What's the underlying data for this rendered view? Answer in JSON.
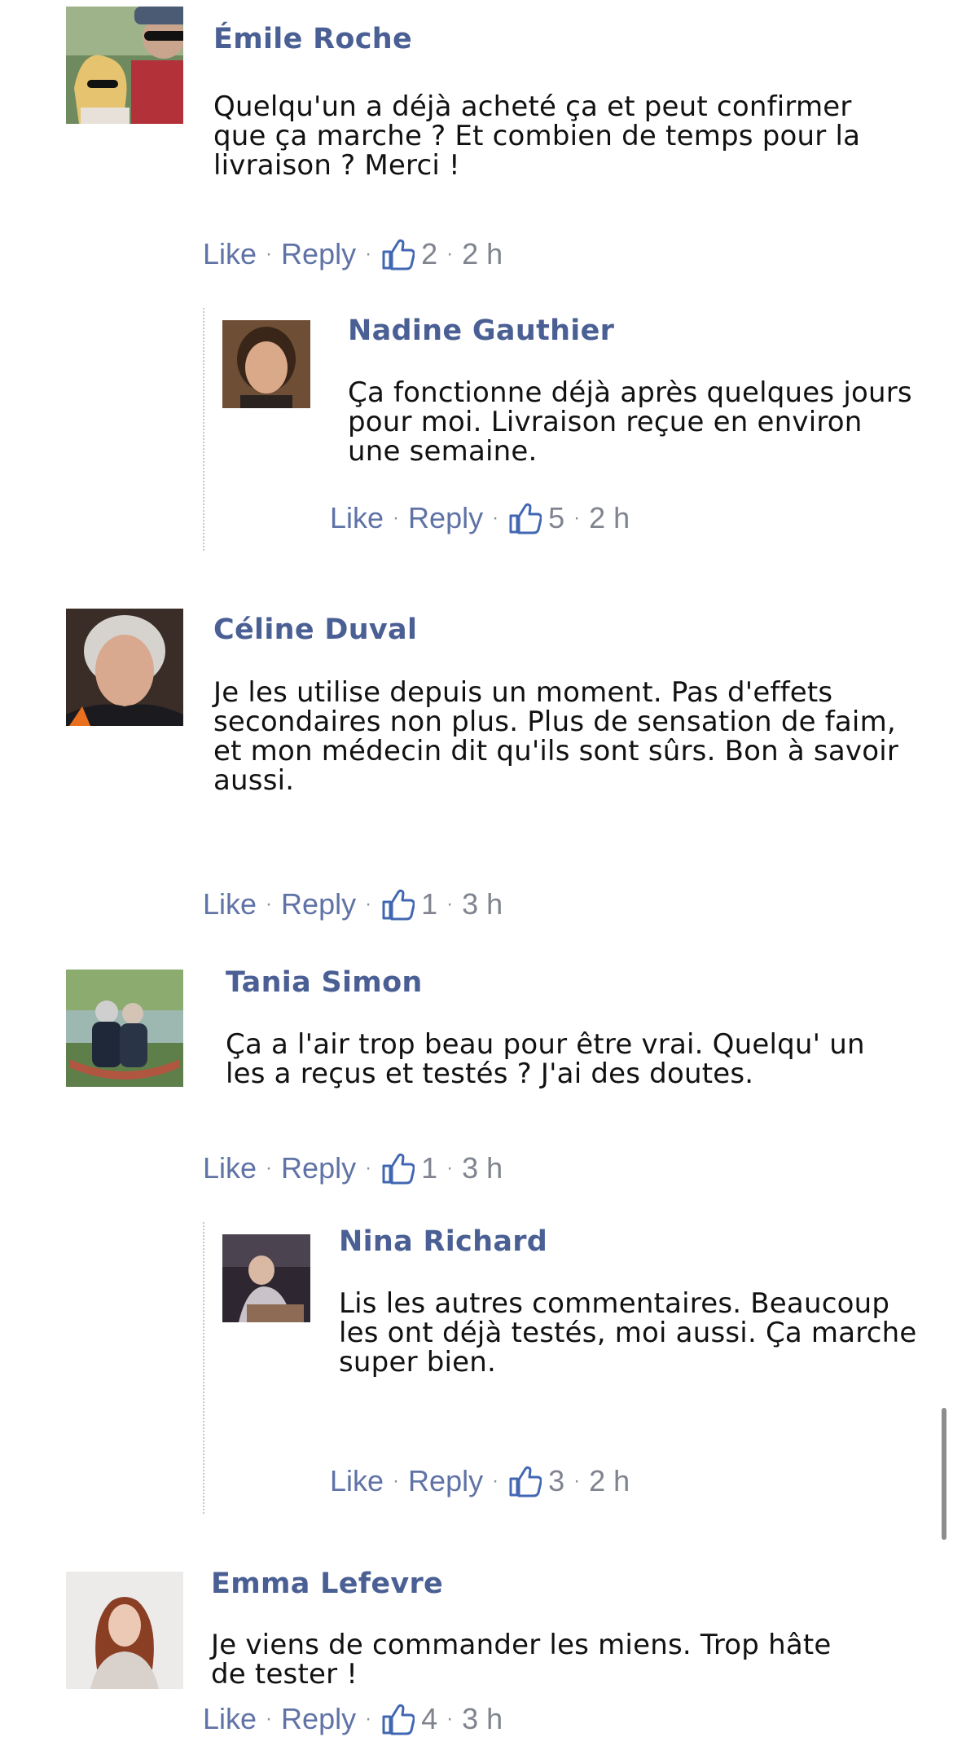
{
  "comments": [
    {
      "author": "Émile Roche",
      "text": "Quelqu'un a déjà acheté ça et peut confirmer que ça marche ? Et combien de temps pour la livraison ? Merci !",
      "like_label": "Like",
      "reply_label": "Reply",
      "likes": "2",
      "time": "2 h"
    },
    {
      "author": "Nadine Gauthier",
      "text": "Ça fonctionne déjà après quelques jours pour moi. Livraison reçue en environ une semaine.",
      "like_label": "Like",
      "reply_label": "Reply",
      "likes": "5",
      "time": "2 h"
    },
    {
      "author": "Céline Duval",
      "text": "Je les utilise depuis un moment. Pas d'effets secondaires non plus. Plus de sensation de faim, et mon médecin dit qu'ils sont sûrs. Bon à savoir aussi.",
      "like_label": "Like",
      "reply_label": "Reply",
      "likes": "1",
      "time": "3 h"
    },
    {
      "author": "Tania Simon",
      "text": "Ça a l'air trop beau pour être vrai. Quelqu' un les a reçus et testés ? J'ai des doutes.",
      "like_label": "Like",
      "reply_label": "Reply",
      "likes": "1",
      "time": "3 h"
    },
    {
      "author": "Nina Richard",
      "text": "Lis les autres commentaires. Beaucoup les ont déjà testés, moi aussi. Ça marche super bien.",
      "like_label": "Like",
      "reply_label": "Reply",
      "likes": "3",
      "time": "2 h"
    },
    {
      "author": "Emma Lefevre",
      "text": "Je viens de commander les miens. Trop hâte de tester !",
      "like_label": "Like",
      "reply_label": "Reply",
      "likes": "4",
      "time": "3 h"
    }
  ],
  "icons": {
    "avatar": "avatar",
    "like": "thumbs-up-icon"
  },
  "colors": {
    "author": "#4a5f94",
    "link": "#6073a7",
    "muted": "#80848f",
    "text": "#111111"
  }
}
